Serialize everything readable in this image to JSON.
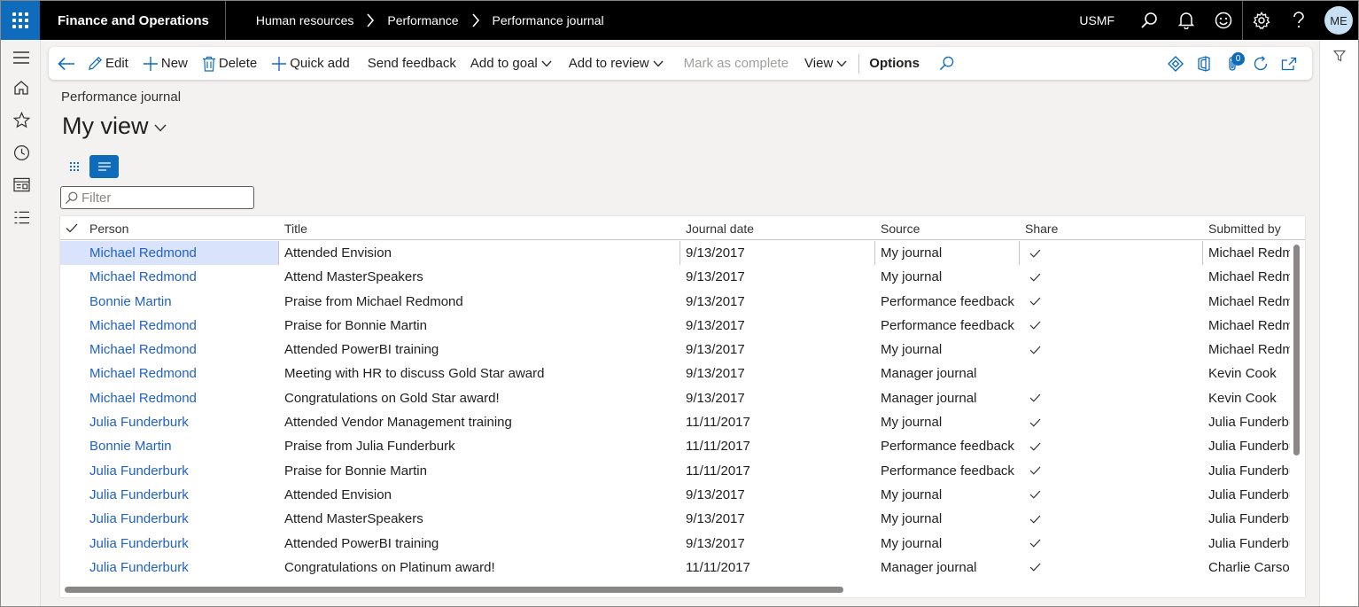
{
  "app": {
    "title": "Finance and Operations",
    "company": "USMF",
    "user_initials": "ME"
  },
  "breadcrumbs": [
    {
      "label": "Human resources"
    },
    {
      "label": "Performance"
    },
    {
      "label": "Performance journal"
    }
  ],
  "actions": {
    "edit": "Edit",
    "new": "New",
    "delete": "Delete",
    "quick_add": "Quick add",
    "send_feedback": "Send feedback",
    "add_to_goal": "Add to goal",
    "add_to_review": "Add to review",
    "mark_as_complete": "Mark as complete",
    "view": "View",
    "options": "Options",
    "attachments_count": "0"
  },
  "page": {
    "caption": "Performance journal",
    "view_name": "My view"
  },
  "filter": {
    "placeholder": "Filter",
    "value": ""
  },
  "grid": {
    "columns": [
      "Person",
      "Title",
      "Journal date",
      "Source",
      "Share",
      "Submitted by"
    ],
    "rows": [
      {
        "person": "Michael Redmond",
        "title": "Attended Envision",
        "date": "9/13/2017",
        "source": "My journal",
        "share": true,
        "submitted_by": "Michael Redmond",
        "selected": true
      },
      {
        "person": "Michael Redmond",
        "title": "Attend MasterSpeakers",
        "date": "9/13/2017",
        "source": "My journal",
        "share": true,
        "submitted_by": "Michael Redmond"
      },
      {
        "person": "Bonnie Martin",
        "title": "Praise from Michael Redmond",
        "date": "9/13/2017",
        "source": "Performance feedback",
        "share": true,
        "submitted_by": "Michael Redmond"
      },
      {
        "person": "Michael Redmond",
        "title": "Praise for Bonnie Martin",
        "date": "9/13/2017",
        "source": "Performance feedback",
        "share": true,
        "submitted_by": "Michael Redmond"
      },
      {
        "person": "Michael Redmond",
        "title": "Attended PowerBI training",
        "date": "9/13/2017",
        "source": "My journal",
        "share": true,
        "submitted_by": "Michael Redmond"
      },
      {
        "person": "Michael Redmond",
        "title": "Meeting with HR to discuss Gold Star award",
        "date": "9/13/2017",
        "source": "Manager journal",
        "share": false,
        "submitted_by": "Kevin Cook"
      },
      {
        "person": "Michael Redmond",
        "title": "Congratulations on Gold Star award!",
        "date": "9/13/2017",
        "source": "Manager journal",
        "share": true,
        "submitted_by": "Kevin Cook"
      },
      {
        "person": "Julia Funderburk",
        "title": "Attended Vendor Management training",
        "date": "11/11/2017",
        "source": "My journal",
        "share": true,
        "submitted_by": "Julia Funderburk"
      },
      {
        "person": "Bonnie Martin",
        "title": "Praise from Julia Funderburk",
        "date": "11/11/2017",
        "source": "Performance feedback",
        "share": true,
        "submitted_by": "Julia Funderburk"
      },
      {
        "person": "Julia Funderburk",
        "title": "Praise for Bonnie Martin",
        "date": "11/11/2017",
        "source": "Performance feedback",
        "share": true,
        "submitted_by": "Julia Funderburk"
      },
      {
        "person": "Julia Funderburk",
        "title": "Attended Envision",
        "date": "9/13/2017",
        "source": "My journal",
        "share": true,
        "submitted_by": "Julia Funderburk"
      },
      {
        "person": "Julia Funderburk",
        "title": "Attend MasterSpeakers",
        "date": "9/13/2017",
        "source": "My journal",
        "share": true,
        "submitted_by": "Julia Funderburk"
      },
      {
        "person": "Julia Funderburk",
        "title": "Attended PowerBI training",
        "date": "9/13/2017",
        "source": "My journal",
        "share": true,
        "submitted_by": "Julia Funderburk"
      },
      {
        "person": "Julia Funderburk",
        "title": "Congratulations on Platinum award!",
        "date": "11/11/2017",
        "source": "Manager journal",
        "share": true,
        "submitted_by": "Charlie Carson"
      }
    ]
  },
  "colors": {
    "brand": "#0f6cbd",
    "link": "#2161c4",
    "selected_row": "#d9e4fc"
  }
}
